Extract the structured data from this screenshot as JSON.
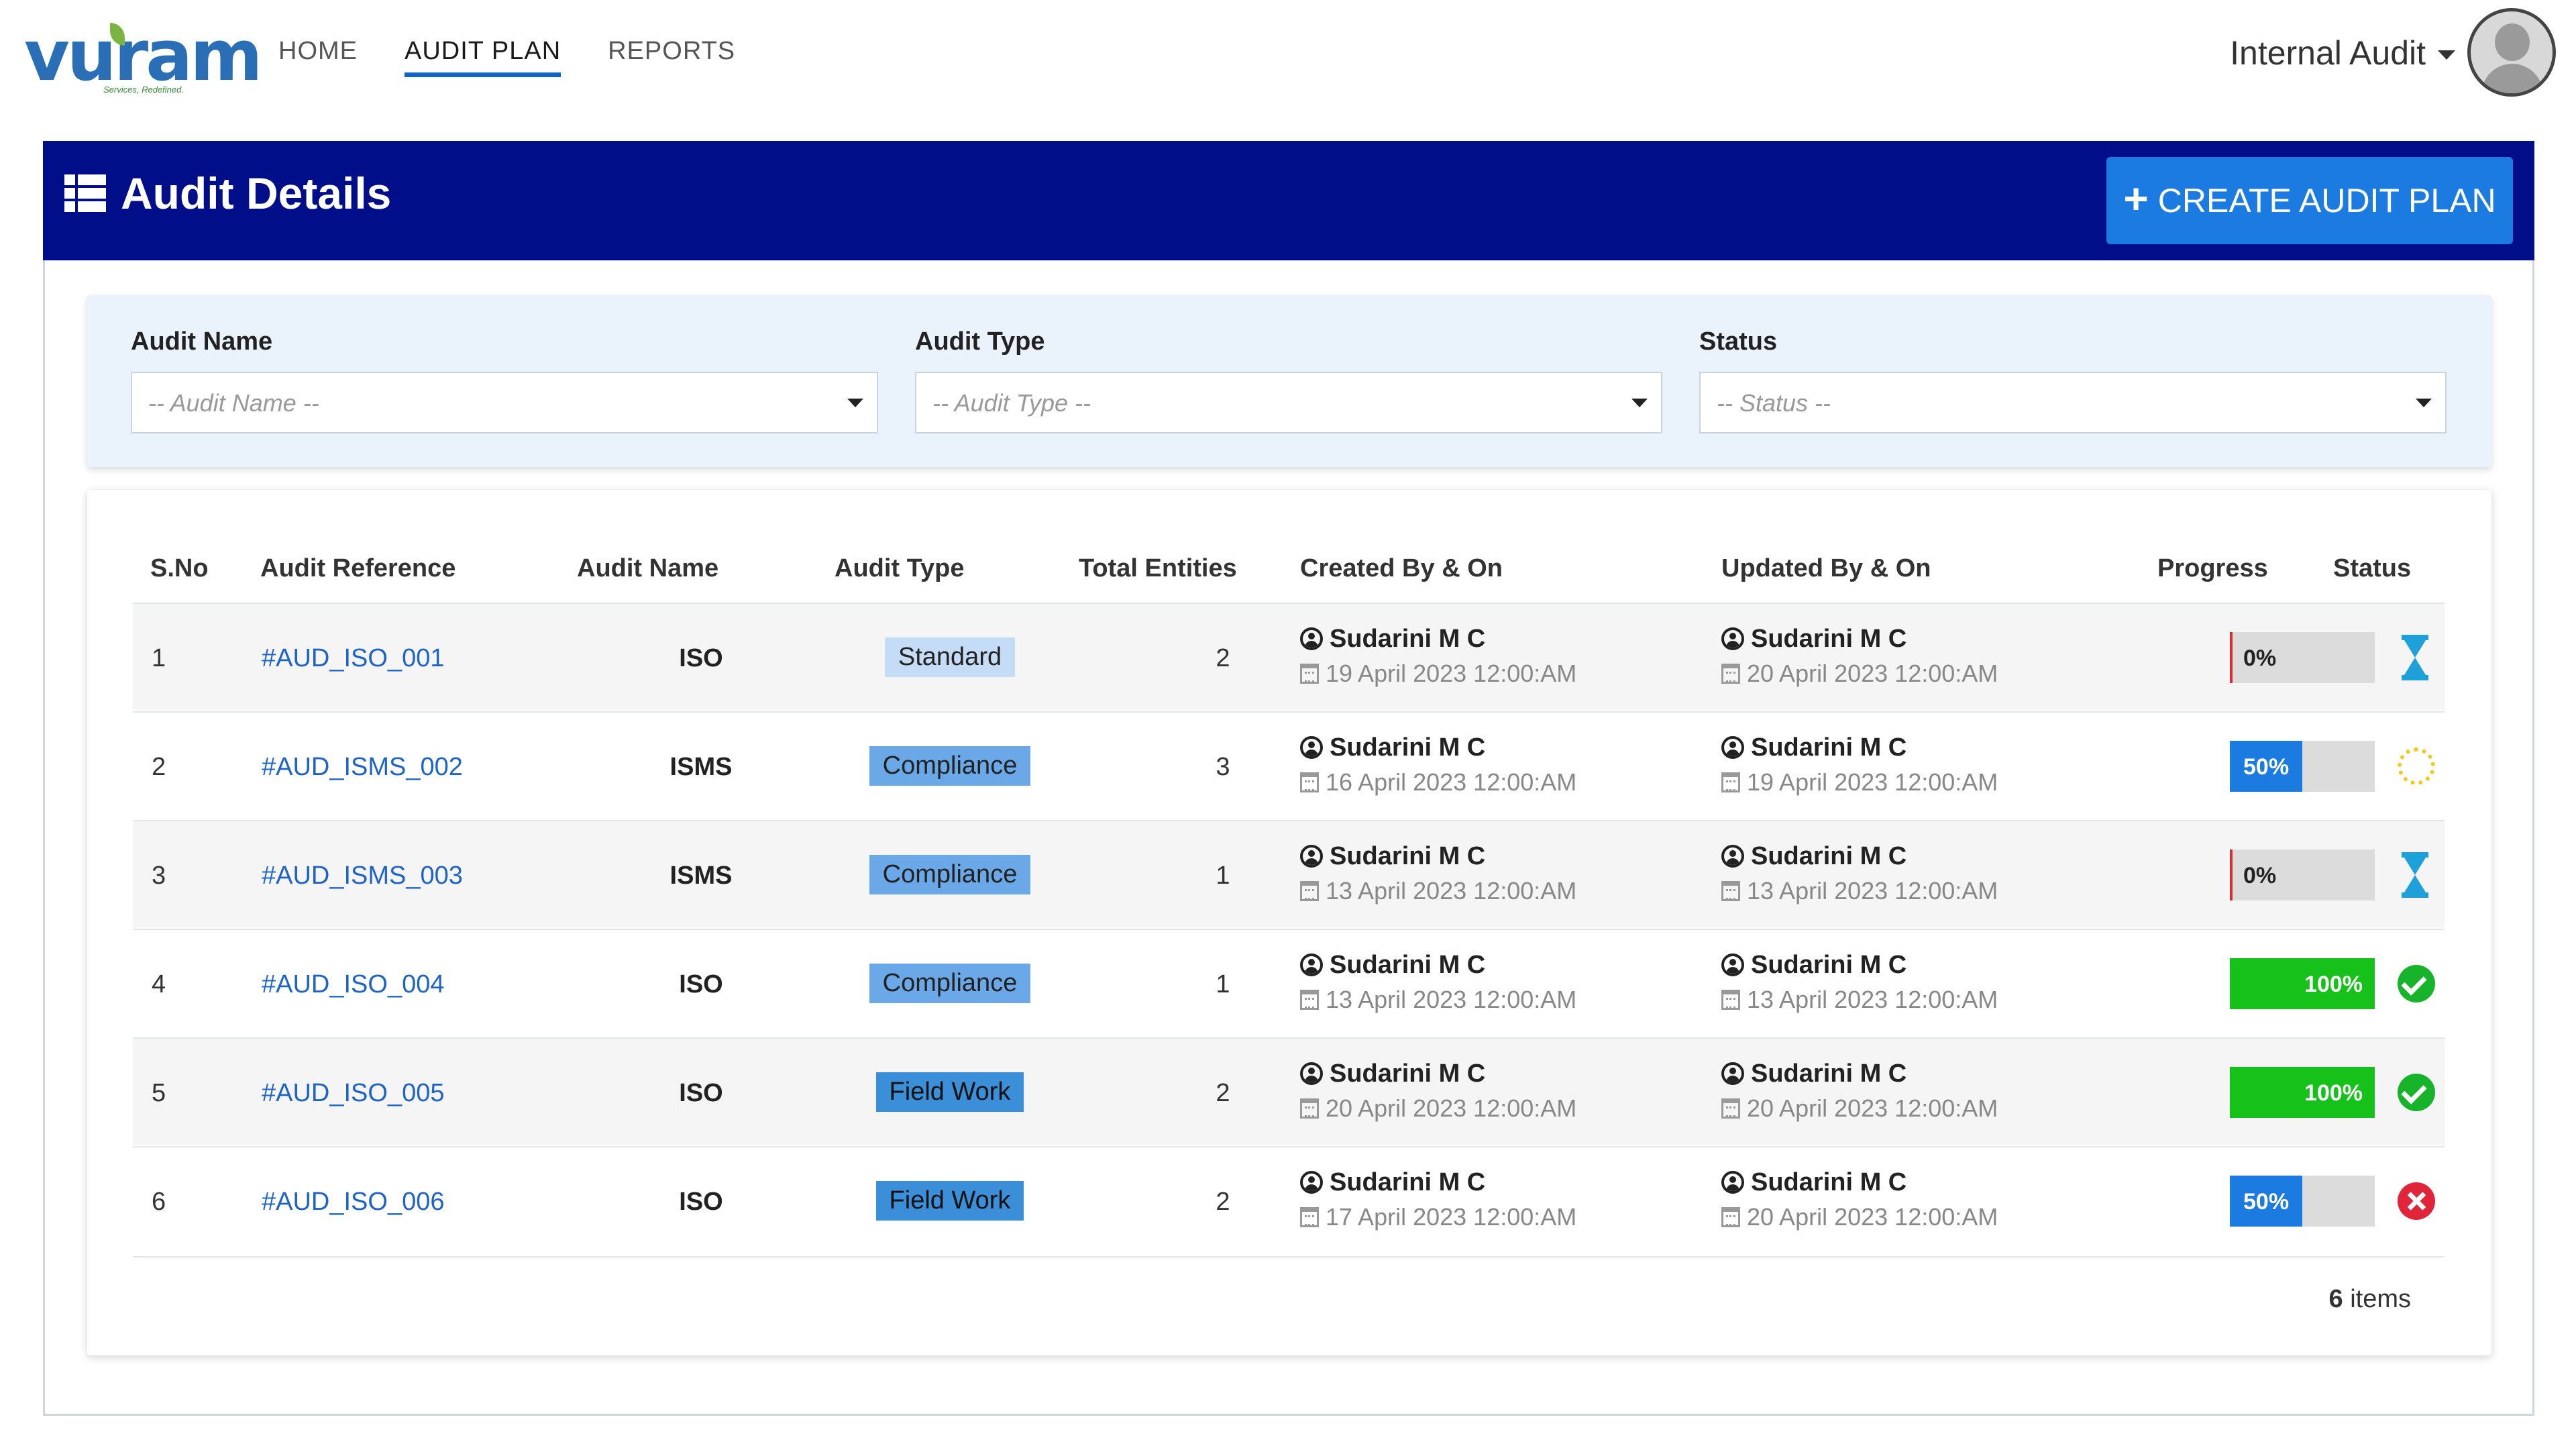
{
  "brand": {
    "logo_text": "vuram",
    "tagline": "Services, Redefined."
  },
  "nav": {
    "items": [
      {
        "label": "HOME",
        "active": false
      },
      {
        "label": "AUDIT PLAN",
        "active": true
      },
      {
        "label": "REPORTS",
        "active": false
      }
    ],
    "user_menu": "Internal Audit",
    "avatar_icon": "user-avatar-icon"
  },
  "header": {
    "title": "Audit Details",
    "icon": "list-grid-icon",
    "create_button": "CREATE AUDIT PLAN",
    "color": "#000e8a",
    "button_color": "#1b7be0"
  },
  "filters": [
    {
      "label": "Audit Name",
      "placeholder": "-- Audit Name --"
    },
    {
      "label": "Audit Type",
      "placeholder": "-- Audit Type --"
    },
    {
      "label": "Status",
      "placeholder": "-- Status --"
    }
  ],
  "table": {
    "columns": [
      "S.No",
      "Audit Reference",
      "Audit Name",
      "Audit Type",
      "Total Entities",
      "Created By & On",
      "Updated By & On",
      "Progress",
      "Status"
    ],
    "rows": [
      {
        "sno": "1",
        "ref": "#AUD_ISO_001",
        "name": "ISO",
        "type": "Standard",
        "type_color": "#c5dcf7",
        "entities": "2",
        "created_by": "Sudarini M C",
        "created_on": "19 April 2023 12:00:AM",
        "updated_by": "Sudarini M C",
        "updated_on": "20 April 2023 12:00:AM",
        "progress": 0,
        "progress_label": "0%",
        "status": "waiting"
      },
      {
        "sno": "2",
        "ref": "#AUD_ISMS_002",
        "name": "ISMS",
        "type": "Compliance",
        "type_color": "#6aa8e8",
        "entities": "3",
        "created_by": "Sudarini M C",
        "created_on": "16 April 2023 12:00:AM",
        "updated_by": "Sudarini M C",
        "updated_on": "19 April 2023 12:00:AM",
        "progress": 50,
        "progress_label": "50%",
        "status": "in-progress"
      },
      {
        "sno": "3",
        "ref": "#AUD_ISMS_003",
        "name": "ISMS",
        "type": "Compliance",
        "type_color": "#6aa8e8",
        "entities": "1",
        "created_by": "Sudarini M C",
        "created_on": "13 April 2023 12:00:AM",
        "updated_by": "Sudarini M C",
        "updated_on": "13 April 2023 12:00:AM",
        "progress": 0,
        "progress_label": "0%",
        "status": "waiting"
      },
      {
        "sno": "4",
        "ref": "#AUD_ISO_004",
        "name": "ISO",
        "type": "Compliance",
        "type_color": "#6aa8e8",
        "entities": "1",
        "created_by": "Sudarini M C",
        "created_on": "13 April 2023 12:00:AM",
        "updated_by": "Sudarini M C",
        "updated_on": "13 April 2023 12:00:AM",
        "progress": 100,
        "progress_label": "100%",
        "status": "completed"
      },
      {
        "sno": "5",
        "ref": "#AUD_ISO_005",
        "name": "ISO",
        "type": "Field Work",
        "type_color": "#3a8fd8",
        "entities": "2",
        "created_by": "Sudarini M C",
        "created_on": "20 April 2023 12:00:AM",
        "updated_by": "Sudarini M C",
        "updated_on": "20 April 2023 12:00:AM",
        "progress": 100,
        "progress_label": "100%",
        "status": "completed"
      },
      {
        "sno": "6",
        "ref": "#AUD_ISO_006",
        "name": "ISO",
        "type": "Field Work",
        "type_color": "#3a8fd8",
        "entities": "2",
        "created_by": "Sudarini M C",
        "created_on": "17 April 2023 12:00:AM",
        "updated_by": "Sudarini M C",
        "updated_on": "20 April 2023 12:00:AM",
        "progress": 50,
        "progress_label": "50%",
        "status": "rejected"
      }
    ],
    "progress_colors": {
      "partial": "#1b7be0",
      "complete": "#16c21a",
      "track": "#dcdcdc"
    },
    "status_icons": {
      "waiting": "hourglass-icon",
      "in-progress": "spinner-icon",
      "completed": "check-circle-icon",
      "rejected": "x-circle-icon"
    },
    "count_number": "6",
    "count_suffix": "items"
  }
}
